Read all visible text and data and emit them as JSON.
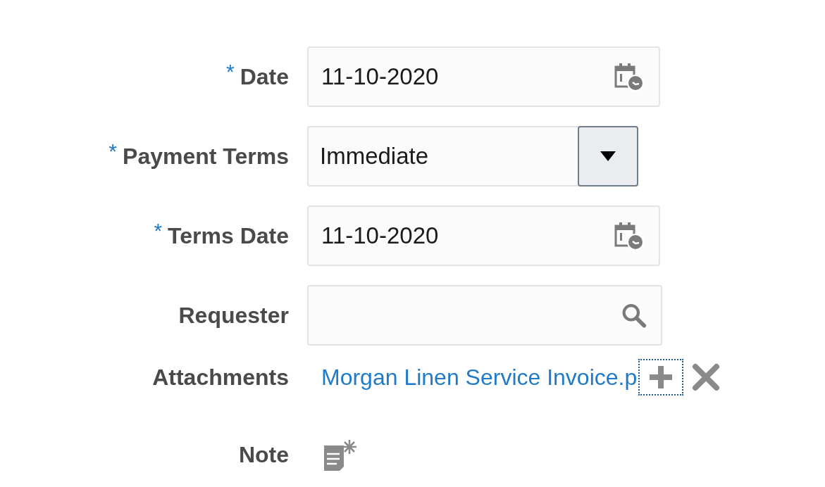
{
  "fields": [
    {
      "kind": "date",
      "label": "Date",
      "required_mark": "*",
      "value": "11-10-2020"
    },
    {
      "kind": "select",
      "label": "Payment Terms",
      "required_mark": "*",
      "value": "Immediate"
    },
    {
      "kind": "date",
      "label": "Terms Date",
      "required_mark": "*",
      "value": "11-10-2020"
    },
    {
      "kind": "search",
      "label": "Requester"
    },
    {
      "kind": "attachment",
      "label": "Attachments",
      "link": "Morgan Linen Service Invoice.p",
      "add_focused": true
    },
    {
      "kind": "note",
      "label": "Note"
    }
  ]
}
